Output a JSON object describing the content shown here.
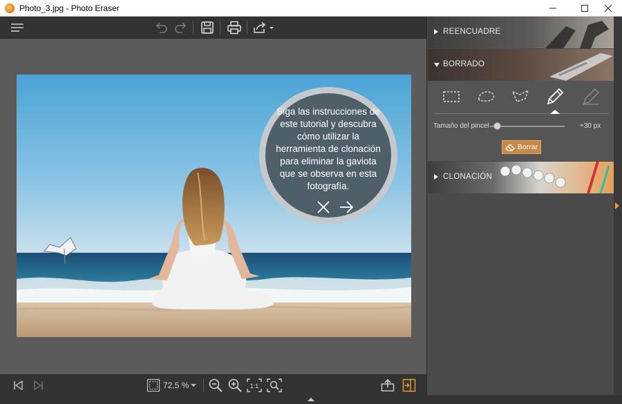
{
  "window": {
    "title": "Photo_3.jpg - Photo Eraser",
    "controls": [
      "minimize",
      "maximize",
      "close"
    ]
  },
  "toolbar": {
    "buttons": [
      "menu-icon",
      "undo-icon",
      "redo-icon",
      "save-icon",
      "print-icon",
      "share-icon"
    ]
  },
  "canvas": {
    "tip_text": "Siga las instrucciones de este tutorial y descubra cómo utilizar la herramienta de clonación para eliminar la gaviota que se observa en esta fotografía."
  },
  "bottom_bar": {
    "zoom": "72,5 %",
    "zoom_buttons": [
      "zoom-out-icon",
      "zoom-in-icon",
      "actual-size-icon",
      "fit-icon"
    ],
    "actual_size_label": "1:1"
  },
  "panel": {
    "sections": {
      "reencuadre": "REENCUADRE",
      "borrado": "BORRADO",
      "clonacion": "CLONACIÓN"
    },
    "borrado": {
      "tools": [
        "rectangle-select-icon",
        "lasso-icon",
        "polygon-lasso-icon",
        "brush-icon",
        "eraser-pen-icon"
      ],
      "active_tool": "brush-icon",
      "brush_label": "Tamaño del pincel",
      "brush_size": "+30 px",
      "brush_level": 0.1,
      "erase_button": "Borrar"
    }
  },
  "colors": {
    "accent": "#f0a030",
    "panel_bg": "#4a4a4a",
    "toolbar_bg": "#333333",
    "canvas_bg": "#5b5b5b",
    "tip_bg": "#4e5f6a"
  }
}
